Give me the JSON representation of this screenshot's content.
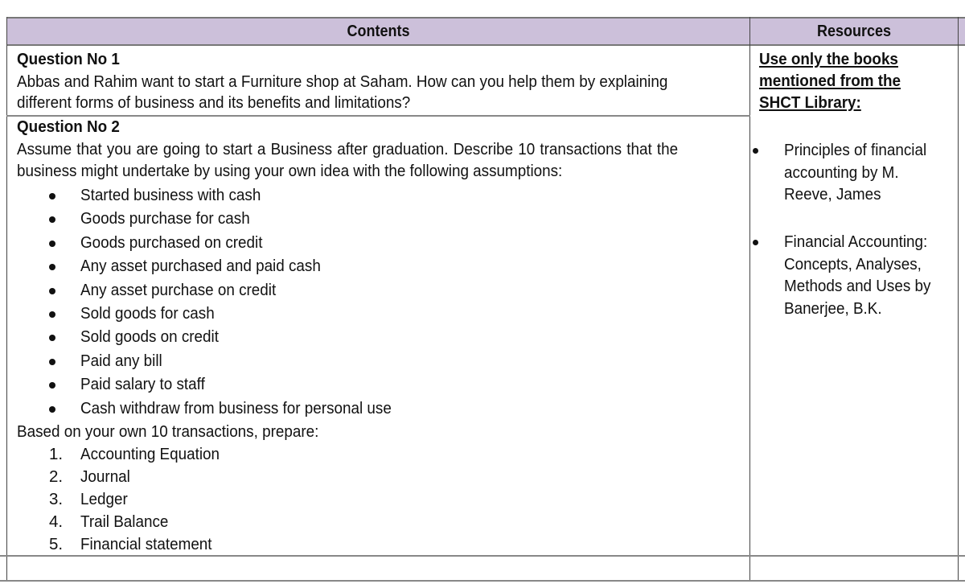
{
  "header": {
    "contents": "Contents",
    "resources": "Resources"
  },
  "q1": {
    "title": "Question No 1",
    "lines": [
      "Abbas and Rahim want to start a Furniture shop at Saham. How can you help them by explaining",
      "different forms of business and its benefits and limitations?"
    ]
  },
  "q2": {
    "title": "Question No 2",
    "lines": [
      "Assume that you are going to start a Business after graduation. Describe 10 transactions that the",
      "business might undertake by using your own idea with the following assumptions:"
    ],
    "bullets": [
      "Started business with cash",
      "Goods purchase for cash",
      "Goods purchased on credit",
      "Any asset purchased and paid cash",
      "Any asset purchase on credit",
      "Sold goods for cash",
      "Sold goods on credit",
      "Paid any bill",
      "Paid salary to staff",
      "Cash withdraw from business for personal use"
    ],
    "prepare_intro": "Based on your own 10 transactions, prepare:",
    "prepare": [
      {
        "n": "1.",
        "t": "Accounting Equation"
      },
      {
        "n": "2.",
        "t": "Journal"
      },
      {
        "n": "3.",
        "t": "Ledger"
      },
      {
        "n": "4.",
        "t": "Trail Balance"
      },
      {
        "n": "5.",
        "t": "Financial statement"
      }
    ]
  },
  "resources": {
    "heading_lines": [
      "Use only the books",
      "mentioned from the",
      "SHCT Library:"
    ],
    "books": [
      {
        "lines": [
          "Principles of financial",
          "accounting by M.",
          "Reeve, James"
        ]
      },
      {
        "lines": [
          "Financial Accounting:",
          "Concepts, Analyses,",
          "Methods and Uses by",
          "Banerjee, B.K."
        ]
      }
    ]
  }
}
